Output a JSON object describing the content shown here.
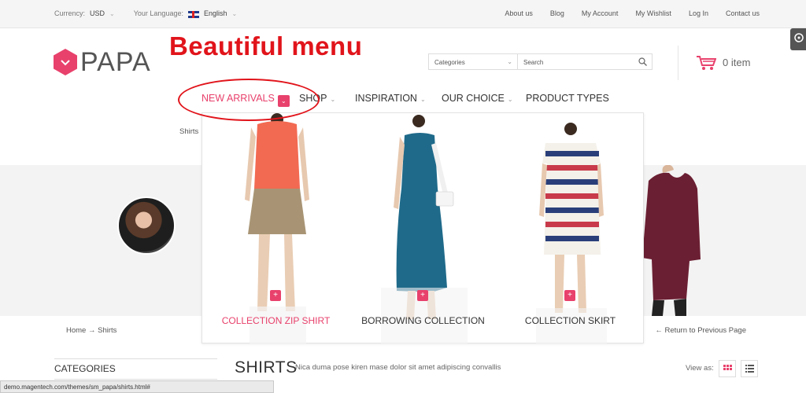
{
  "topbar": {
    "currency_label": "Currency:",
    "currency_value": "USD",
    "language_label": "Your Language:",
    "language_value": "English",
    "links": [
      "About us",
      "Blog",
      "My Account",
      "My Wishlist",
      "Log In",
      "Contact us"
    ]
  },
  "header": {
    "logo_text": "PAPA",
    "annotation": "Beautiful menu",
    "category_select": "Categories",
    "search_placeholder": "Search",
    "cart_text": "0 item"
  },
  "nav": {
    "items": [
      "NEW ARRIVALS",
      "SHOP",
      "INSPIRATION",
      "OUR CHOICE",
      "PRODUCT TYPES"
    ],
    "active_index": 0
  },
  "page": {
    "crumb_top": "Shirts",
    "breadcrumb_home": "Home",
    "breadcrumb_current": "Shirts",
    "return_link": "Return to Previous Page",
    "categories_heading": "CATEGORIES",
    "title": "SHIRTS",
    "description": "Nica duma pose kiren mase dolor sit amet adipiscing convallis",
    "view_as": "View as:",
    "status_url": "demo.magentech.com/themes/sm_papa/shirts.html#"
  },
  "dropdown": {
    "products": [
      {
        "label": "COLLECTION ZIP SHIRT",
        "active": true
      },
      {
        "label": "BORROWING COLLECTION",
        "active": false
      },
      {
        "label": "COLLECTION SKIRT",
        "active": false
      }
    ]
  },
  "colors": {
    "accent": "#e8416c",
    "annotation_red": "#e1141b"
  }
}
